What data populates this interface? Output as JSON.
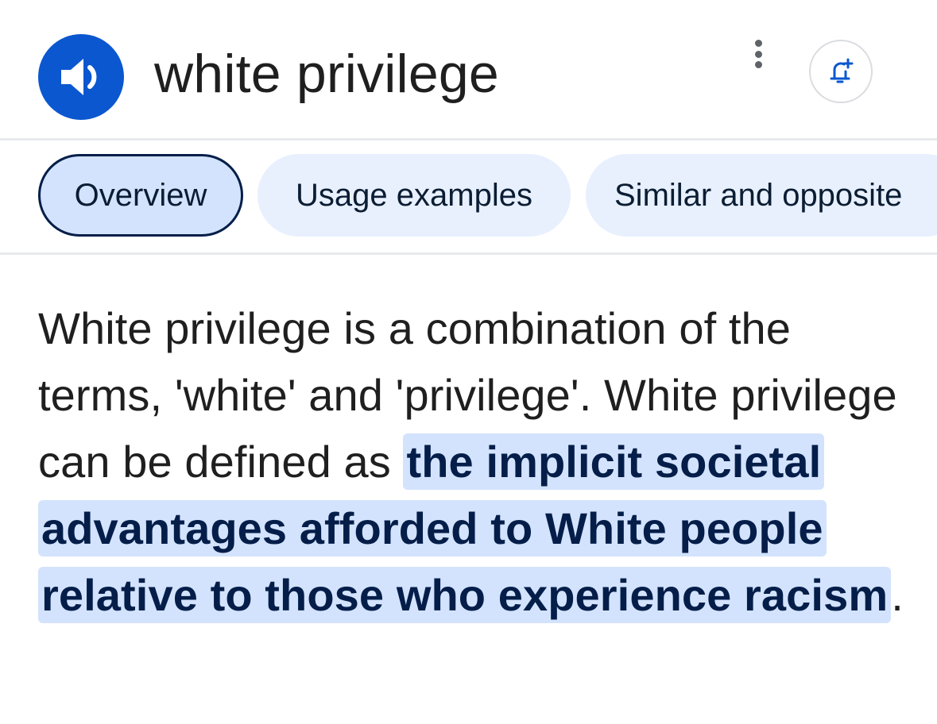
{
  "header": {
    "term": "white privilege",
    "speak_icon": "volume-up-icon",
    "more_icon": "more-vert-icon",
    "alert_icon": "add-alert-icon"
  },
  "tabs": [
    {
      "label": "Overview",
      "selected": true
    },
    {
      "label": "Usage examples",
      "selected": false
    },
    {
      "label": "Similar and opposite",
      "selected": false
    }
  ],
  "definition": {
    "intro": "White privilege is a combination of the terms, 'white' and 'privilege'. White privilege can be defined as ",
    "highlight": "the implicit societal advantages afforded to White people relative to those who experience racism",
    "end": "."
  },
  "colors": {
    "accent": "#0b57d0",
    "chip_selected_bg": "#d3e3fd",
    "chip_bg": "#e8f0fe",
    "highlight_bg": "#d3e3fd",
    "text": "#1f1f1f"
  }
}
